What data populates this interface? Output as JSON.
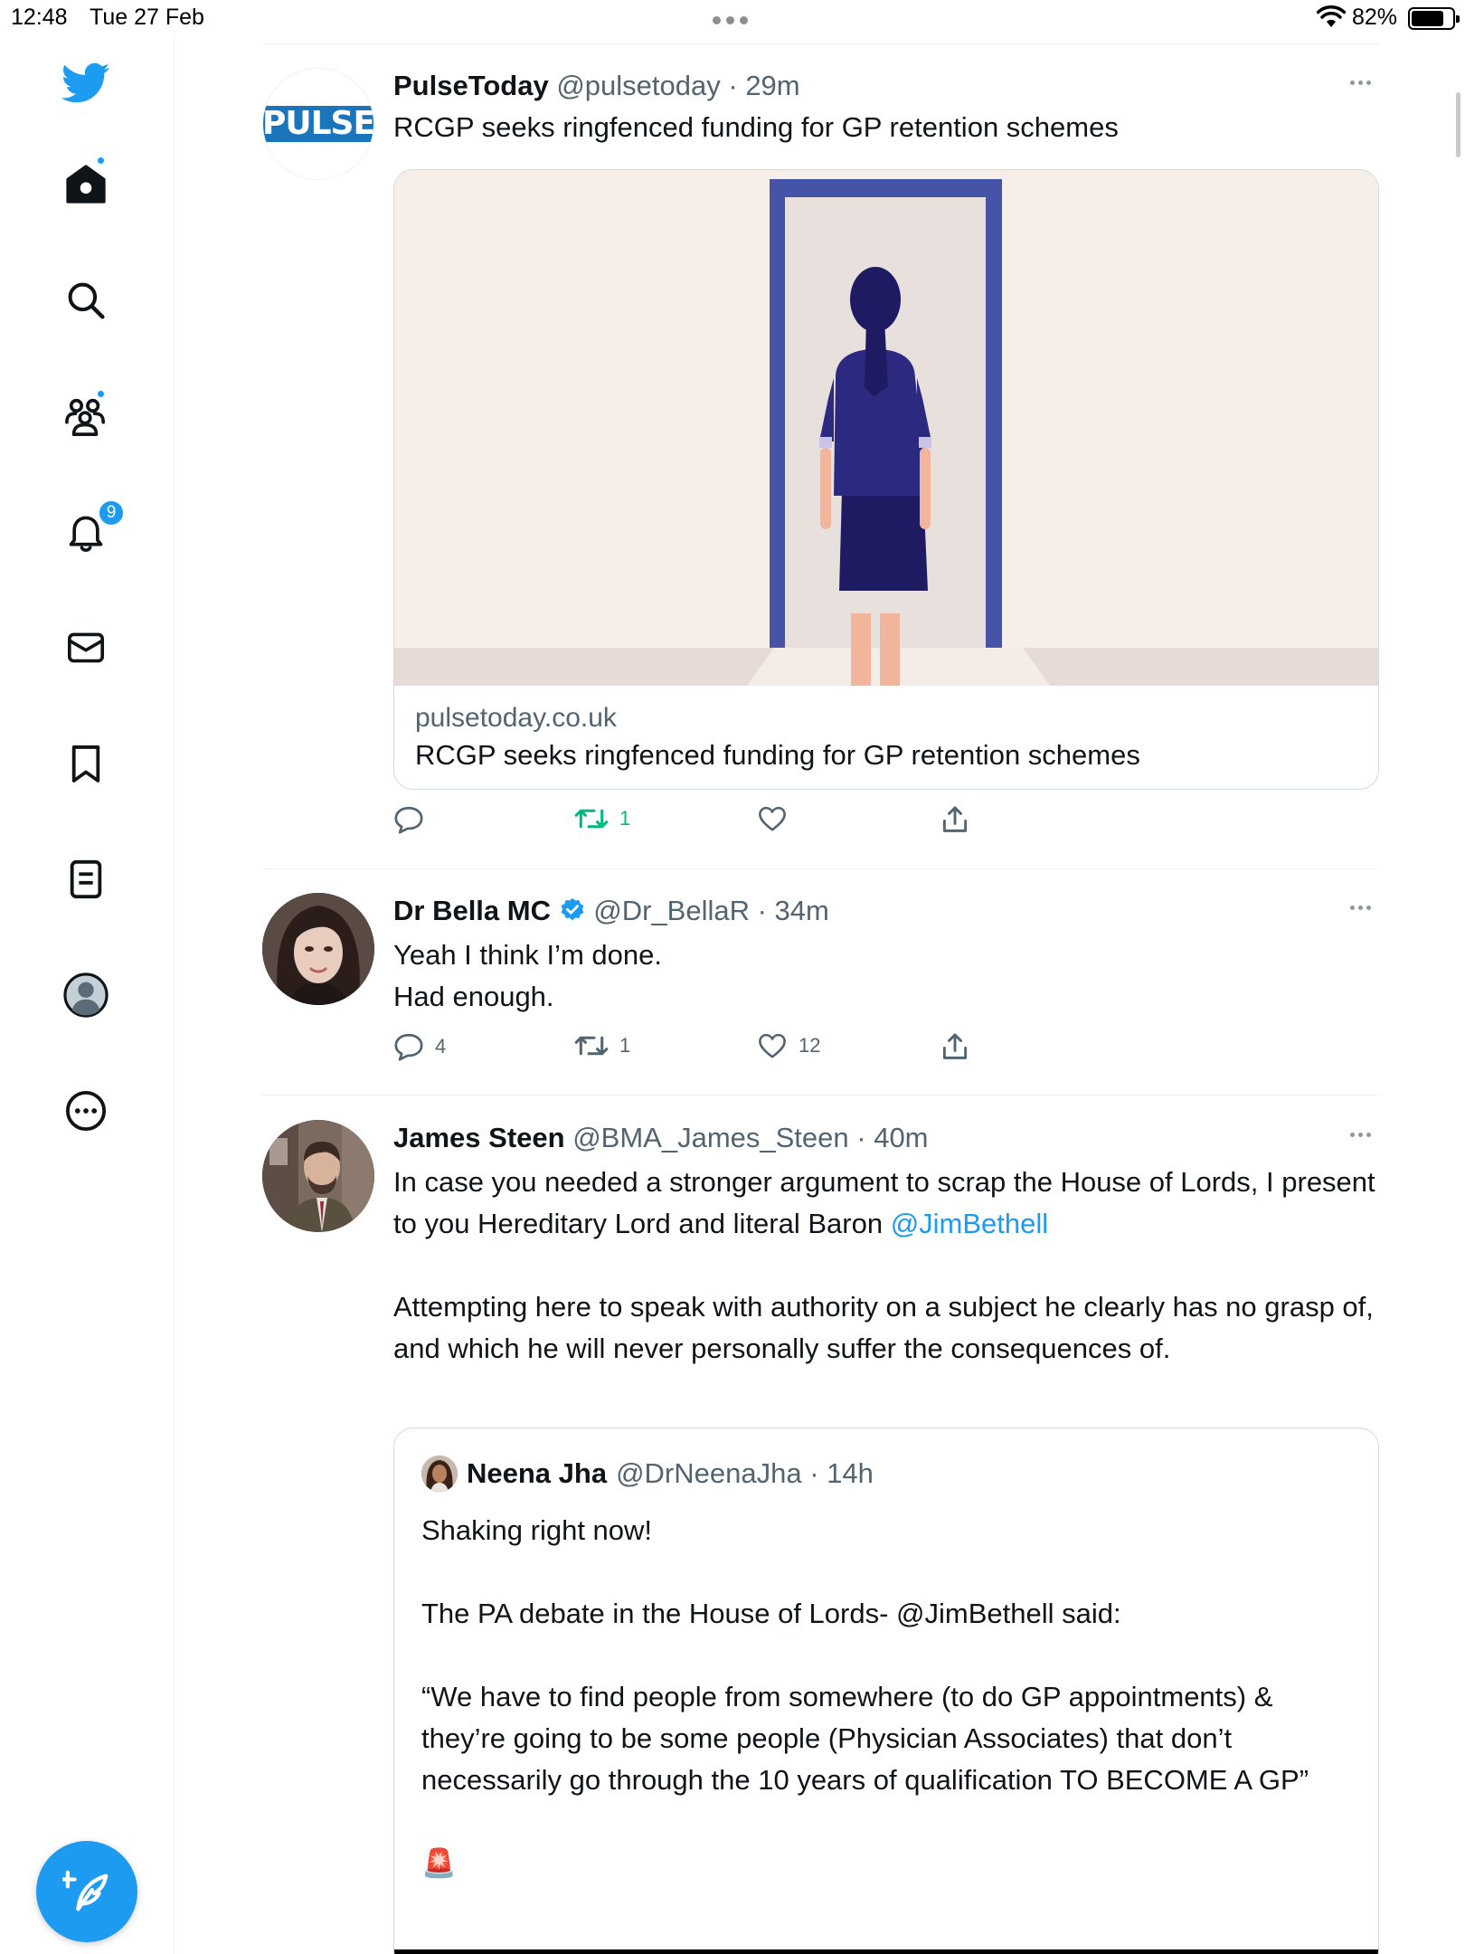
{
  "status_bar": {
    "time": "12:48",
    "date": "Tue 27 Feb",
    "battery": "82%"
  },
  "sidebar": {
    "accent_color": "#1d9bf0",
    "items": [
      {
        "icon": "twitter-bird-icon"
      },
      {
        "icon": "home-icon",
        "has_dot": true
      },
      {
        "icon": "search-icon"
      },
      {
        "icon": "communities-icon",
        "has_dot": true
      },
      {
        "icon": "bell-icon",
        "badge": "9"
      },
      {
        "icon": "mail-icon"
      },
      {
        "icon": "bookmark-icon"
      },
      {
        "icon": "lists-icon"
      },
      {
        "icon": "profile-avatar-icon"
      },
      {
        "icon": "more-circle-icon"
      }
    ],
    "compose_icon": "compose-feather-icon"
  },
  "tweets": [
    {
      "name": "PulseToday",
      "handle": "@pulsetoday",
      "time": "29m",
      "avatar_text": "PULSE",
      "text": "RCGP seeks ringfenced funding for GP retention schemes",
      "card": {
        "domain": "pulsetoday.co.uk",
        "title": "RCGP seeks ringfenced funding for GP retention schemes"
      },
      "actions": {
        "replies": "",
        "retweets": "1",
        "likes": ""
      }
    },
    {
      "name": "Dr Bella MC",
      "handle": "@Dr_BellaR",
      "time": "34m",
      "verified": true,
      "text": "Yeah I think I’m done.\nHad enough.",
      "actions": {
        "replies": "4",
        "retweets": "1",
        "likes": "12"
      }
    },
    {
      "name": "James Steen",
      "handle": "@BMA_James_Steen",
      "time": "40m",
      "text_before_mention": "In case you needed a stronger argument to scrap the House of Lords, I present to you Hereditary Lord and literal Baron ",
      "mention": "@JimBethell",
      "text_after": "Attempting here to speak with authority on a subject he clearly has no grasp of, and which he will never personally suffer the consequences of.",
      "quote": {
        "name": "Neena Jha",
        "handle": "@DrNeenaJha",
        "time": "14h",
        "text": "Shaking right now!\n\nThe PA debate in the House of Lords- @JimBethell said:\n\n“We have to find people from somewhere (to do GP appointments) & they’re going to be some people (Physician Associates) that don’t necessarily go through the 10 years of qualification TO BECOME A GP”\n\n🚨"
      }
    }
  ]
}
